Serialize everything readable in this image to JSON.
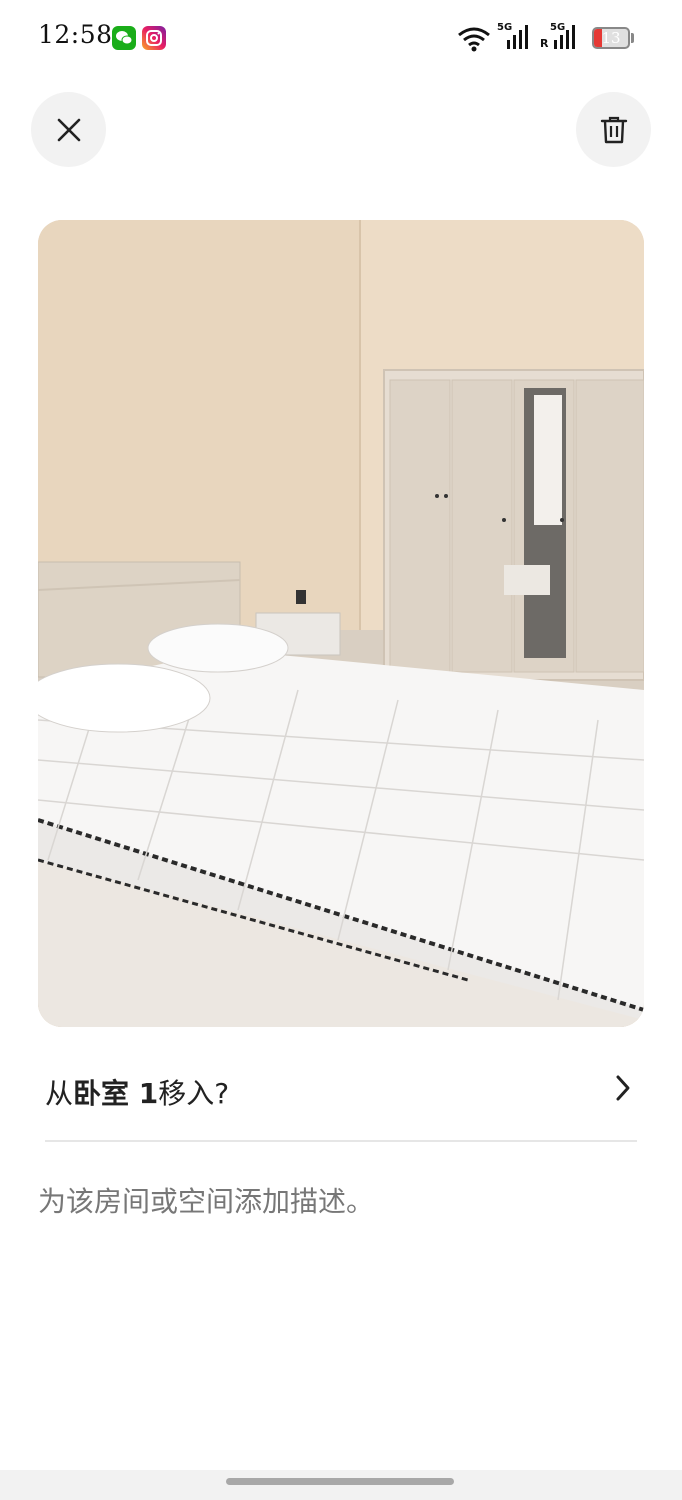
{
  "status_bar": {
    "time": "12:58",
    "battery_level": "13",
    "signal_1_label": "5G",
    "signal_2_label": "5G",
    "signal_2_roaming": "R",
    "notification_icons": [
      "wechat-icon",
      "instagram-icon"
    ],
    "status_icons": [
      "wifi-icon",
      "signal-5g-icon",
      "signal-5g-roaming-icon",
      "battery-icon"
    ]
  },
  "toolbar": {
    "close_icon": "close-icon",
    "delete_icon": "trash-icon"
  },
  "photo": {
    "subject": "bedroom with bed and wardrobe"
  },
  "move_row": {
    "prefix": "从",
    "room_name": "卧室 1",
    "suffix": "移入?",
    "chevron_icon": "chevron-right-icon"
  },
  "description": {
    "placeholder": "为该房间或空间添加描述。"
  },
  "colors": {
    "background": "#ffffff",
    "button_bg": "#f2f2f2",
    "text_primary": "#222222",
    "text_secondary": "#777777",
    "divider": "#e6e6e6",
    "battery_low": "#e53935"
  }
}
